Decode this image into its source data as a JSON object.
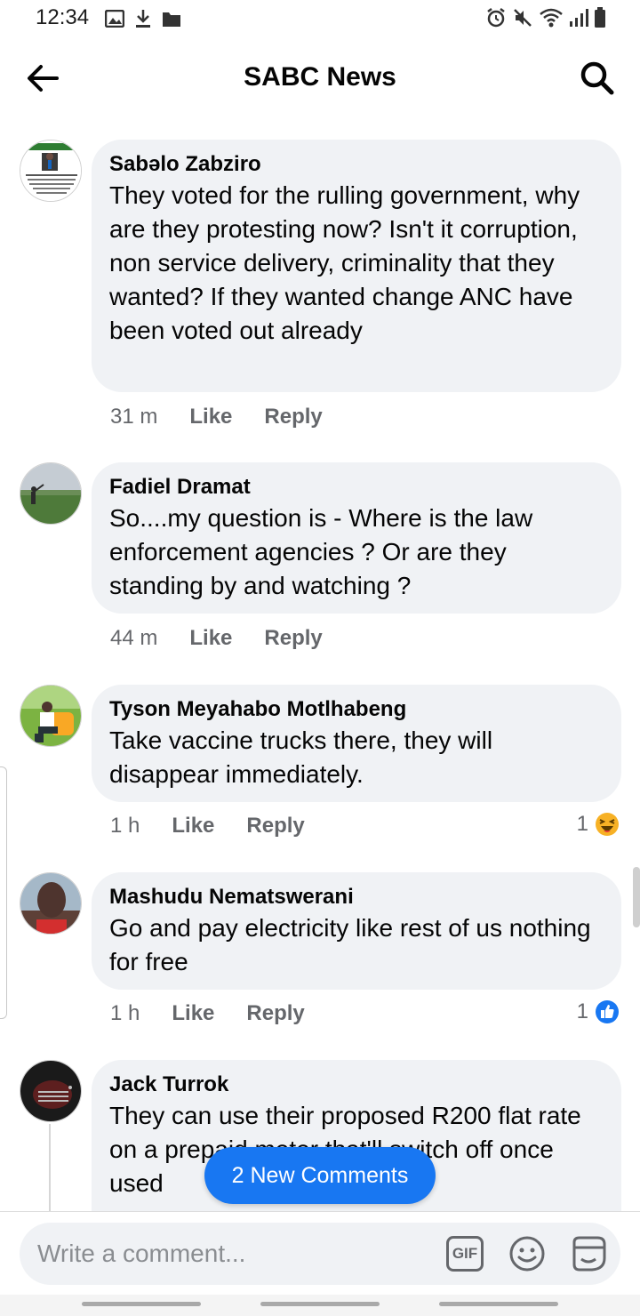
{
  "status_bar": {
    "time": "12:34",
    "left_icons": [
      "image-icon",
      "download-icon",
      "folder-icon"
    ],
    "right_icons": [
      "alarm-icon",
      "mute-icon",
      "wifi-icon",
      "signal-icon",
      "battery-icon"
    ]
  },
  "header": {
    "title": "SABC News",
    "back_icon": "back-arrow-icon",
    "search_icon": "search-icon"
  },
  "comments": [
    {
      "author": "Sabəlo Zabziro",
      "text": "They voted for the rulling government, why are they protesting now? Isn't it corruption, non service delivery, criminality that they wanted? If they wanted change ANC have been voted out already",
      "time": "31 m",
      "like_label": "Like",
      "reply_label": "Reply"
    },
    {
      "author": "Fadiel Dramat",
      "text": "So....my question is - Where is the law enforcement agencies ? Or are they standing by and watching ?",
      "time": "44 m",
      "like_label": "Like",
      "reply_label": "Reply"
    },
    {
      "author": "Tyson Meyahabo Motlhabeng",
      "text": "Take vaccine trucks there, they will disappear immediately.",
      "time": "1 h",
      "like_label": "Like",
      "reply_label": "Reply",
      "reaction_count": "1",
      "reaction_icon": "haha-reaction-icon"
    },
    {
      "author": "Mashudu Nematswerani",
      "text": "Go and pay electricity like rest of us nothing for free",
      "time": "1 h",
      "like_label": "Like",
      "reply_label": "Reply",
      "reaction_count": "1",
      "reaction_icon": "like-reaction-icon"
    },
    {
      "author": "Jack Turrok",
      "text": "They can use their proposed R200 flat rate on a prepaid meter that'll switch off once used"
    }
  ],
  "new_comments_label": "2 New Comments",
  "composer": {
    "placeholder": "Write a comment...",
    "gif_label": "GIF",
    "emoji_icon": "emoji-icon",
    "sticker_icon": "sticker-icon"
  },
  "colors": {
    "accent": "#1877f2",
    "bubble": "#f0f2f5",
    "meta_text": "#65676b",
    "haha": "#f7b125"
  }
}
